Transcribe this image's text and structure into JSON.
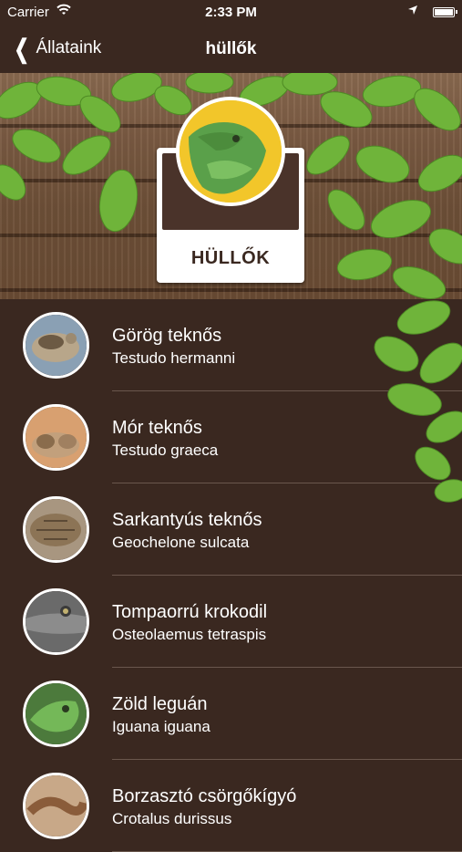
{
  "status_bar": {
    "carrier": "Carrier",
    "time": "2:33 PM"
  },
  "nav": {
    "back_label": "Állataink",
    "title": "hüllők"
  },
  "header": {
    "badge_title": "HÜLLŐK"
  },
  "animals": [
    {
      "name": "Görög teknős",
      "latin": "Testudo hermanni"
    },
    {
      "name": "Mór teknős",
      "latin": "Testudo graeca"
    },
    {
      "name": "Sarkantyús teknős",
      "latin": "Geochelone sulcata"
    },
    {
      "name": "Tompaorrú krokodil",
      "latin": "Osteolaemus tetraspis"
    },
    {
      "name": "Zöld leguán",
      "latin": "Iguana iguana"
    },
    {
      "name": "Borzasztó csörgőkígyó",
      "latin": "Crotalus durissus"
    }
  ],
  "colors": {
    "background": "#3a2820",
    "leaf": "#6fb43a",
    "badge_accent": "#f2c62a"
  }
}
